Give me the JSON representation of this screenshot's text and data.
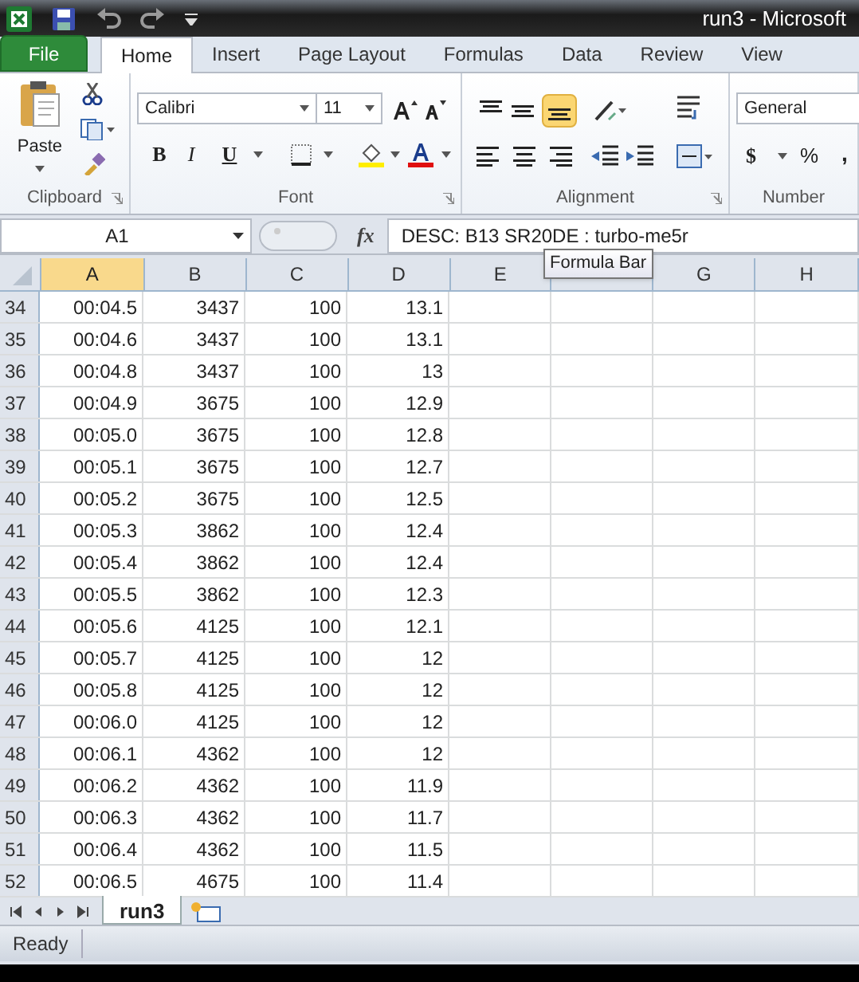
{
  "window": {
    "title": "run3  -  Microsoft"
  },
  "ribbon_tabs": [
    {
      "label": "File",
      "kind": "file"
    },
    {
      "label": "Home",
      "kind": "tab",
      "selected": true
    },
    {
      "label": "Insert",
      "kind": "tab",
      "selected": false
    },
    {
      "label": "Page Layout",
      "kind": "tab",
      "selected": false
    },
    {
      "label": "Formulas",
      "kind": "tab",
      "selected": false
    },
    {
      "label": "Data",
      "kind": "tab",
      "selected": false
    },
    {
      "label": "Review",
      "kind": "tab",
      "selected": false
    },
    {
      "label": "View",
      "kind": "tab",
      "selected": false
    }
  ],
  "clipboard": {
    "paste_label": "Paste",
    "group_label": "Clipboard"
  },
  "font": {
    "name": "Calibri",
    "size": "11",
    "bold": "B",
    "italic": "I",
    "underline": "U",
    "group_label": "Font"
  },
  "alignment": {
    "bottom_align_on": true,
    "group_label": "Alignment"
  },
  "number": {
    "format": "General",
    "currency": "$",
    "percent": "%",
    "comma": ",",
    "group_label": "Number"
  },
  "formula_bar": {
    "name_box": "A1",
    "fx": "fx",
    "value": "DESC: B13 SR20DE : turbo-me5r",
    "tooltip": "Formula Bar"
  },
  "columns": [
    {
      "label": "A",
      "selected": true
    },
    {
      "label": "B",
      "selected": false
    },
    {
      "label": "C",
      "selected": false
    },
    {
      "label": "D",
      "selected": false
    },
    {
      "label": "E",
      "selected": false
    },
    {
      "selected": false
    },
    {
      "label": "G",
      "selected": false
    },
    {
      "label": "H",
      "selected": false
    }
  ],
  "rows": [
    {
      "number": "34",
      "cells": [
        "00:04.5",
        "3437",
        "100",
        "13.1"
      ]
    },
    {
      "number": "35",
      "cells": [
        "00:04.6",
        "3437",
        "100",
        "13.1"
      ]
    },
    {
      "number": "36",
      "cells": [
        "00:04.8",
        "3437",
        "100",
        "13"
      ]
    },
    {
      "number": "37",
      "cells": [
        "00:04.9",
        "3675",
        "100",
        "12.9"
      ]
    },
    {
      "number": "38",
      "cells": [
        "00:05.0",
        "3675",
        "100",
        "12.8"
      ]
    },
    {
      "number": "39",
      "cells": [
        "00:05.1",
        "3675",
        "100",
        "12.7"
      ]
    },
    {
      "number": "40",
      "cells": [
        "00:05.2",
        "3675",
        "100",
        "12.5"
      ]
    },
    {
      "number": "41",
      "cells": [
        "00:05.3",
        "3862",
        "100",
        "12.4"
      ]
    },
    {
      "number": "42",
      "cells": [
        "00:05.4",
        "3862",
        "100",
        "12.4"
      ]
    },
    {
      "number": "43",
      "cells": [
        "00:05.5",
        "3862",
        "100",
        "12.3"
      ]
    },
    {
      "number": "44",
      "cells": [
        "00:05.6",
        "4125",
        "100",
        "12.1"
      ]
    },
    {
      "number": "45",
      "cells": [
        "00:05.7",
        "4125",
        "100",
        "12"
      ]
    },
    {
      "number": "46",
      "cells": [
        "00:05.8",
        "4125",
        "100",
        "12"
      ]
    },
    {
      "number": "47",
      "cells": [
        "00:06.0",
        "4125",
        "100",
        "12"
      ]
    },
    {
      "number": "48",
      "cells": [
        "00:06.1",
        "4362",
        "100",
        "12"
      ]
    },
    {
      "number": "49",
      "cells": [
        "00:06.2",
        "4362",
        "100",
        "11.9"
      ]
    },
    {
      "number": "50",
      "cells": [
        "00:06.3",
        "4362",
        "100",
        "11.7"
      ]
    },
    {
      "number": "51",
      "cells": [
        "00:06.4",
        "4362",
        "100",
        "11.5"
      ]
    },
    {
      "number": "52",
      "cells": [
        "00:06.5",
        "4675",
        "100",
        "11.4"
      ]
    }
  ],
  "sheet_tabs": [
    {
      "label": "run3",
      "selected": true
    }
  ],
  "status_bar": {
    "text": "Ready"
  }
}
